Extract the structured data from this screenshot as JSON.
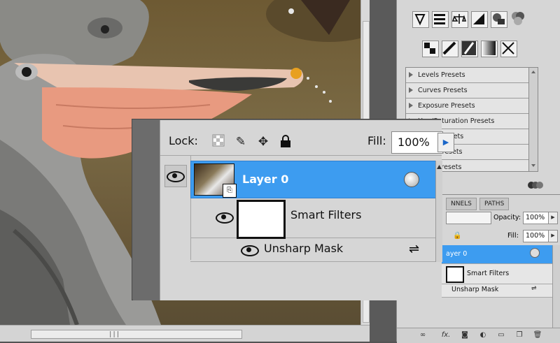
{
  "adjustments": {
    "presets": [
      "Levels Presets",
      "Curves Presets",
      "Exposure Presets",
      "Hue/Saturation Presets",
      "White Presets",
      "Mixer Presets",
      "Color Presets"
    ]
  },
  "small_layers": {
    "tabs": [
      "NNELS",
      "PATHS"
    ],
    "opacity_label": "Opacity:",
    "opacity_value": "100%",
    "fill_label": "Fill:",
    "fill_value": "100%",
    "layer_name": "ayer 0",
    "smart_filters_label": "Smart Filters",
    "filter_name": "Unsharp Mask",
    "bottom_fx": "fx."
  },
  "layers_panel": {
    "lock_label": "Lock:",
    "fill_label": "Fill:",
    "fill_value": "100%",
    "layer_name": "Layer 0",
    "smart_filters_label": "Smart Filters",
    "filter_name": "Unsharp Mask"
  },
  "scrollbar": {
    "grip": "|||"
  },
  "colors": {
    "selection": "#3d9cf0",
    "panel": "#d6d6d6",
    "workspace": "#535353"
  }
}
